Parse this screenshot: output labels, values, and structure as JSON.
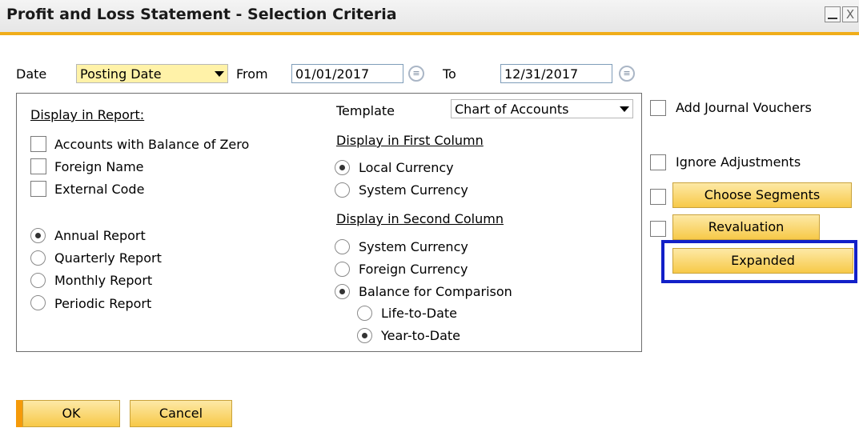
{
  "window": {
    "title": "Profit and Loss Statement - Selection Criteria",
    "close_glyph": "X"
  },
  "date_row": {
    "date_label": "Date",
    "date_type": "Posting Date",
    "from_label": "From",
    "from_value": "01/01/2017",
    "to_label": "To",
    "to_value": "12/31/2017",
    "picker_glyph": "≡"
  },
  "display": {
    "header": "Display in Report:",
    "checks": [
      {
        "label": "Accounts with Balance of Zero",
        "checked": false
      },
      {
        "label": "Foreign Name",
        "checked": false
      },
      {
        "label": "External Code",
        "checked": false
      }
    ],
    "report_types": [
      {
        "label": "Annual Report",
        "selected": true
      },
      {
        "label": "Quarterly Report",
        "selected": false
      },
      {
        "label": "Monthly Report",
        "selected": false
      },
      {
        "label": "Periodic Report",
        "selected": false
      }
    ]
  },
  "template": {
    "label": "Template",
    "value": "Chart of Accounts"
  },
  "first_column": {
    "header": "Display in First Column",
    "options": [
      {
        "label": "Local Currency",
        "selected": true
      },
      {
        "label": "System Currency",
        "selected": false
      }
    ]
  },
  "second_column": {
    "header": "Display in Second Column",
    "options": [
      {
        "label": "System Currency",
        "selected": false
      },
      {
        "label": "Foreign Currency",
        "selected": false
      },
      {
        "label": "Balance for Comparison",
        "selected": true
      }
    ],
    "sub_options": [
      {
        "label": "Life-to-Date",
        "selected": false
      },
      {
        "label": "Year-to-Date",
        "selected": true
      }
    ]
  },
  "right": {
    "add_journal_vouchers": "Add Journal Vouchers",
    "ignore_adjustments": "Ignore Adjustments",
    "choose_segments": "Choose Segments",
    "revaluation": "Revaluation",
    "expanded": "Expanded"
  },
  "footer": {
    "ok": "OK",
    "cancel": "Cancel"
  },
  "colors": {
    "accent": "#f0ad1a",
    "button_fill": "#f7c948",
    "highlight": "#1220c8",
    "combo_fill": "#fff2a8"
  }
}
